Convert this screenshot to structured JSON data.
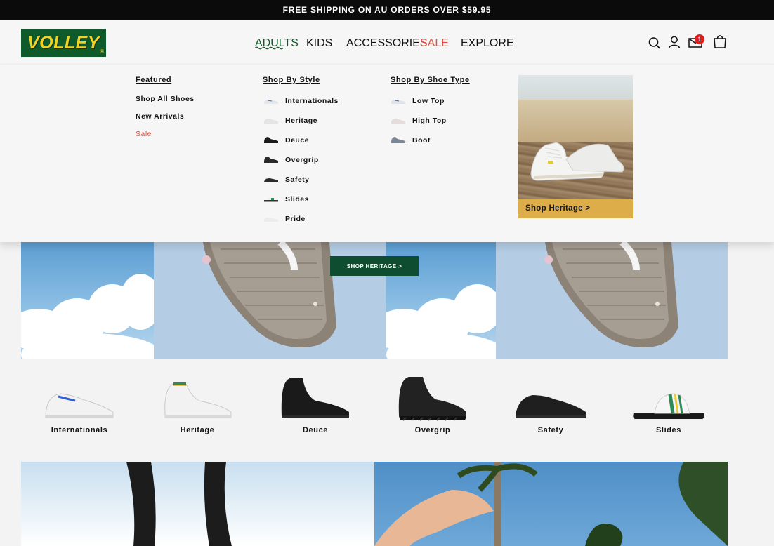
{
  "announcement": "FREE SHIPPING ON AU ORDERS OVER $59.95",
  "brand": {
    "logo_text": "VOLLEY",
    "logo_mark": "®",
    "logo_bg": "#0f5a2a",
    "logo_fg": "#f1d222"
  },
  "nav": {
    "items": [
      "ADULTS",
      "KIDS",
      "ACCESSORIES",
      "SALE",
      "EXPLORE"
    ],
    "active": "ADULTS"
  },
  "header_icons": [
    "search-icon",
    "account-icon",
    "mail-icon",
    "cart-icon"
  ],
  "mail_badge": "1",
  "mega_menu": {
    "featured": {
      "title": "Featured",
      "links": [
        "Shop All Shoes",
        "New Arrivals",
        "Sale"
      ]
    },
    "by_style": {
      "title": "Shop By Style",
      "links": [
        "Internationals",
        "Heritage",
        "Deuce",
        "Overgrip",
        "Safety",
        "Slides",
        "Pride"
      ]
    },
    "by_type": {
      "title": "Shop By Shoe Type",
      "links": [
        "Low Top",
        "High Top",
        "Boot"
      ]
    },
    "promo_label": "Shop Heritage >"
  },
  "hero": {
    "button_label": "SHOP HERITAGE >"
  },
  "categories": [
    "Internationals",
    "Heritage",
    "Deuce",
    "Overgrip",
    "Safety",
    "Slides"
  ],
  "colors": {
    "accent_green": "#0f5a2a",
    "sale_red": "#e0513e",
    "hero_button": "#0f4d30"
  }
}
